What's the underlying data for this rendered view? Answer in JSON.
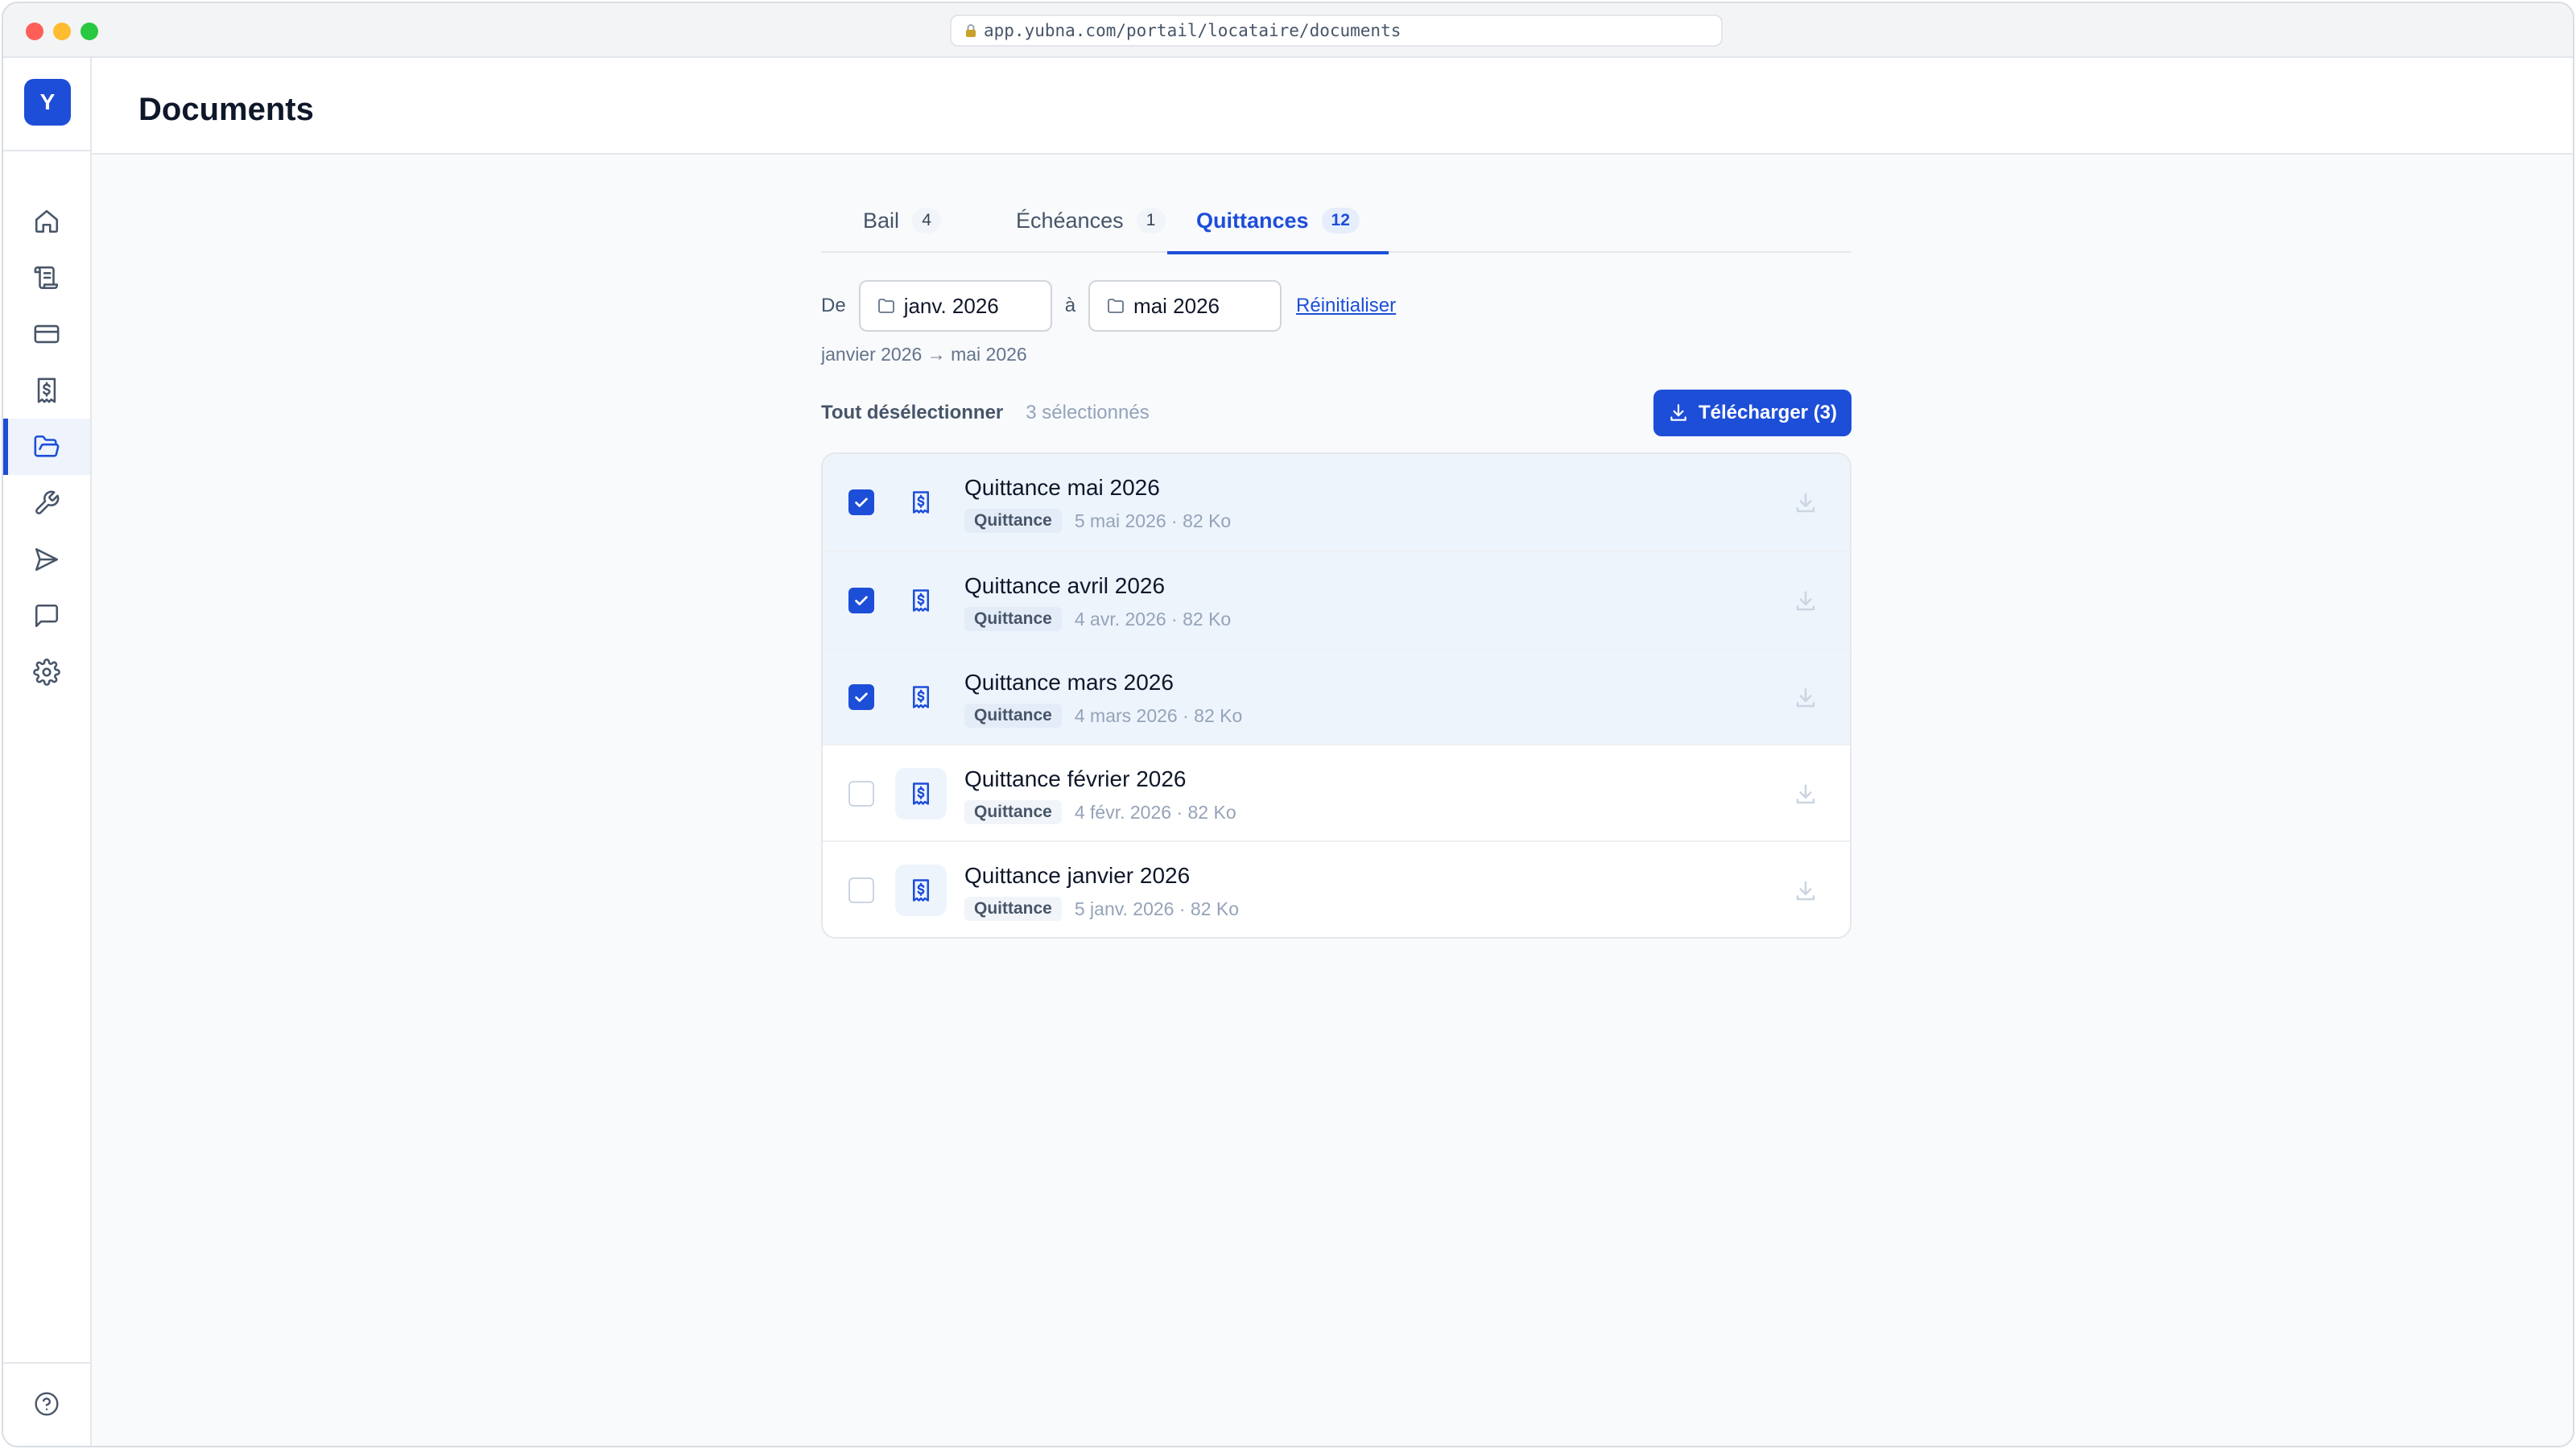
{
  "browser": {
    "url": "app.yubna.com/portail/locataire/documents"
  },
  "sidebar": {
    "logo_letter": "Y",
    "items": [
      {
        "icon": "home-icon",
        "active": false
      },
      {
        "icon": "scroll-icon",
        "active": false
      },
      {
        "icon": "credit-card-icon",
        "active": false
      },
      {
        "icon": "receipt-icon",
        "active": false
      },
      {
        "icon": "folder-open-icon",
        "active": true
      },
      {
        "icon": "wrench-icon",
        "active": false
      },
      {
        "icon": "send-icon",
        "active": false
      },
      {
        "icon": "message-icon",
        "active": false
      },
      {
        "icon": "gear-icon",
        "active": false
      }
    ],
    "help_icon": "help-circle-icon"
  },
  "header": {
    "title": "Documents"
  },
  "tabs": [
    {
      "label": "Bail",
      "count": "4",
      "active": false
    },
    {
      "label": "Échéances",
      "count": "1",
      "active": false
    },
    {
      "label": "Quittances",
      "count": "12",
      "active": true
    }
  ],
  "filters": {
    "from_label": "De",
    "from_value": "janv. 2026",
    "to_label": "à",
    "to_value": "mai 2026",
    "reset_label": "Réinitialiser",
    "range_summary": "janvier 2026 → mai 2026"
  },
  "selection": {
    "deselect_label": "Tout désélectionner",
    "count_label": "3 sélectionnés",
    "download_label": "Télécharger (3)"
  },
  "documents": [
    {
      "name": "Quittance mai 2026",
      "tag": "Quittance",
      "meta": "5 mai 2026 · 82 Ko",
      "selected": true
    },
    {
      "name": "Quittance avril 2026",
      "tag": "Quittance",
      "meta": "4 avr. 2026 · 82 Ko",
      "selected": true
    },
    {
      "name": "Quittance mars 2026",
      "tag": "Quittance",
      "meta": "4 mars 2026 · 82 Ko",
      "selected": true
    },
    {
      "name": "Quittance février 2026",
      "tag": "Quittance",
      "meta": "4 févr. 2026 · 82 Ko",
      "selected": false
    },
    {
      "name": "Quittance janvier 2026",
      "tag": "Quittance",
      "meta": "5 janv. 2026 · 82 Ko",
      "selected": false
    }
  ],
  "colors": {
    "accent": "#1d4ed8",
    "selected_row": "#eef4fc",
    "background": "#f8fafc"
  }
}
